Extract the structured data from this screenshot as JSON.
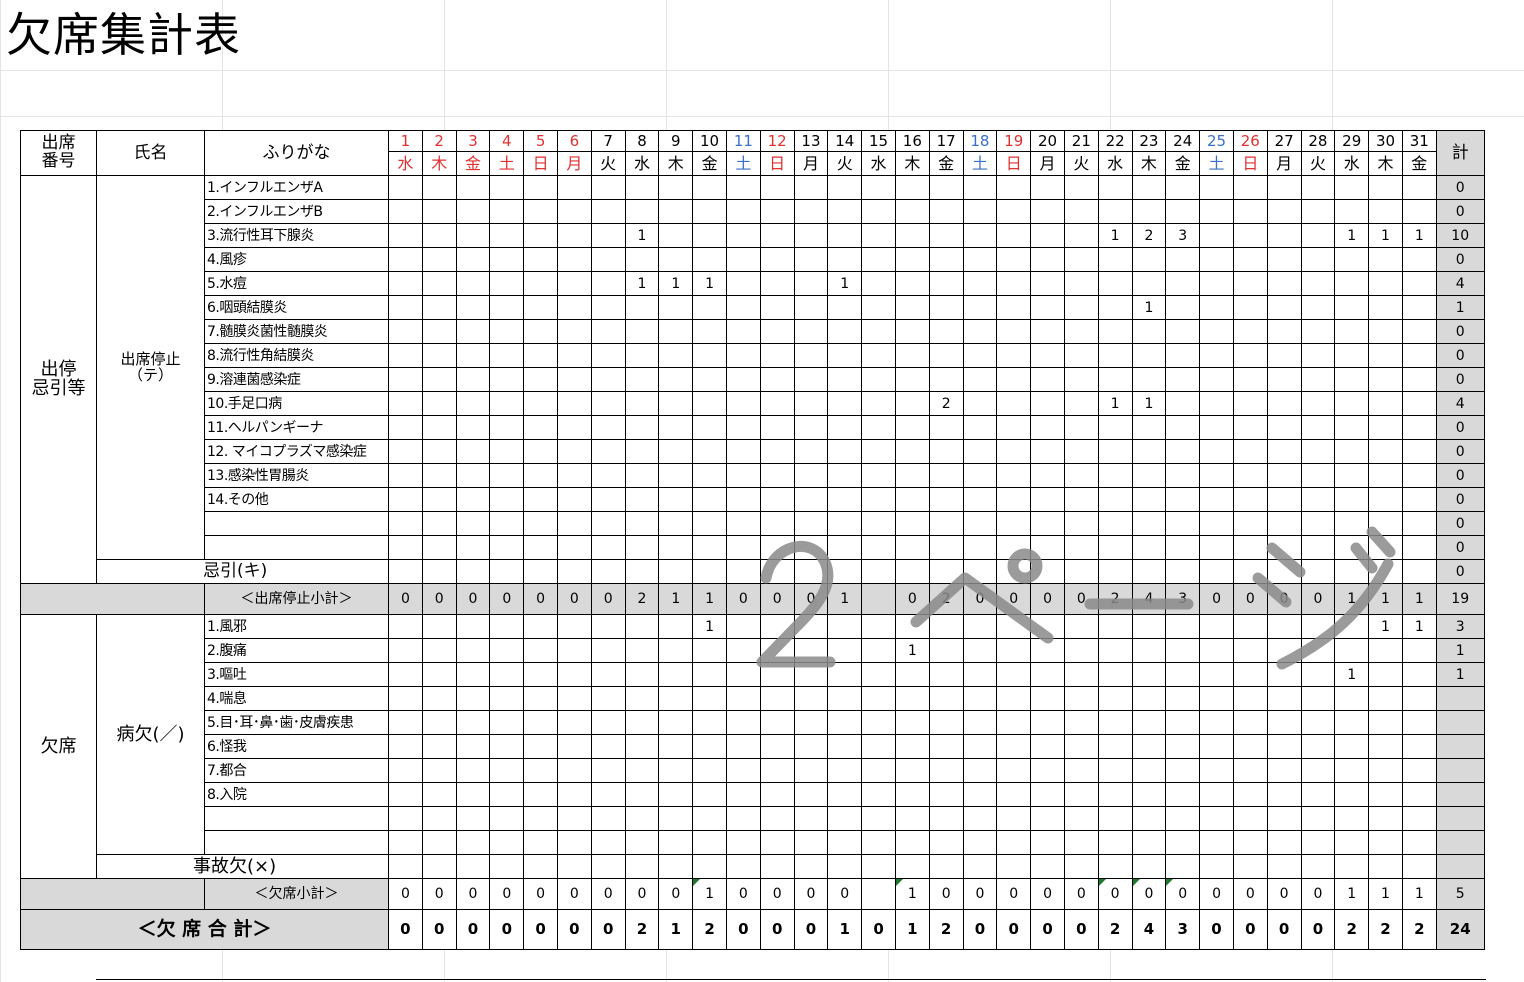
{
  "title": "欠席集計表",
  "header": {
    "number_label": "出席\n番号",
    "name_label": "氏名",
    "kana_label": "ふりがな",
    "total_label": "計"
  },
  "colors": {
    "saturday": "#3a6fc8",
    "holiday": "#e03030",
    "gray_fill": "#d9d9d9"
  },
  "days": [
    {
      "d": "1",
      "w": "水",
      "c": "red"
    },
    {
      "d": "2",
      "w": "木",
      "c": "red"
    },
    {
      "d": "3",
      "w": "金",
      "c": "red"
    },
    {
      "d": "4",
      "w": "土",
      "c": "red"
    },
    {
      "d": "5",
      "w": "日",
      "c": "red"
    },
    {
      "d": "6",
      "w": "月",
      "c": "red"
    },
    {
      "d": "7",
      "w": "火",
      "c": ""
    },
    {
      "d": "8",
      "w": "水",
      "c": ""
    },
    {
      "d": "9",
      "w": "木",
      "c": ""
    },
    {
      "d": "10",
      "w": "金",
      "c": ""
    },
    {
      "d": "11",
      "w": "土",
      "c": "blue"
    },
    {
      "d": "12",
      "w": "日",
      "c": "red"
    },
    {
      "d": "13",
      "w": "月",
      "c": ""
    },
    {
      "d": "14",
      "w": "火",
      "c": ""
    },
    {
      "d": "15",
      "w": "水",
      "c": ""
    },
    {
      "d": "16",
      "w": "木",
      "c": ""
    },
    {
      "d": "17",
      "w": "金",
      "c": ""
    },
    {
      "d": "18",
      "w": "土",
      "c": "blue"
    },
    {
      "d": "19",
      "w": "日",
      "c": "red"
    },
    {
      "d": "20",
      "w": "月",
      "c": ""
    },
    {
      "d": "21",
      "w": "火",
      "c": ""
    },
    {
      "d": "22",
      "w": "水",
      "c": ""
    },
    {
      "d": "23",
      "w": "木",
      "c": ""
    },
    {
      "d": "24",
      "w": "金",
      "c": ""
    },
    {
      "d": "25",
      "w": "土",
      "c": "blue"
    },
    {
      "d": "26",
      "w": "日",
      "c": "red"
    },
    {
      "d": "27",
      "w": "月",
      "c": ""
    },
    {
      "d": "28",
      "w": "火",
      "c": ""
    },
    {
      "d": "29",
      "w": "水",
      "c": ""
    },
    {
      "d": "30",
      "w": "木",
      "c": ""
    },
    {
      "d": "31",
      "w": "金",
      "c": ""
    }
  ],
  "section_suspension": {
    "group_label": "出停\n忌引等",
    "sub_label": "出席停止\n（テ）",
    "kibiki_label": "忌引(キ)",
    "kibiki_total": "0",
    "rows": [
      {
        "reason": "1.インフルエンザA",
        "cells": {},
        "total": "0"
      },
      {
        "reason": "2.インフルエンザB",
        "cells": {},
        "total": "0"
      },
      {
        "reason": "3.流行性耳下腺炎",
        "cells": {
          "8": "1",
          "22": "1",
          "23": "2",
          "24": "3",
          "29": "1",
          "30": "1",
          "31": "1"
        },
        "total": "10"
      },
      {
        "reason": "4.風疹",
        "cells": {},
        "total": "0"
      },
      {
        "reason": "5.水痘",
        "cells": {
          "8": "1",
          "9": "1",
          "10": "1",
          "14": "1"
        },
        "total": "4"
      },
      {
        "reason": "6.咽頭結膜炎",
        "cells": {
          "23": "1"
        },
        "total": "1"
      },
      {
        "reason": "7.髄膜炎菌性髄膜炎",
        "cells": {},
        "total": "0"
      },
      {
        "reason": "8.流行性角結膜炎",
        "cells": {},
        "total": "0"
      },
      {
        "reason": "9.溶連菌感染症",
        "cells": {},
        "total": "0"
      },
      {
        "reason": "10.手足口病",
        "cells": {
          "17": "2",
          "22": "1",
          "23": "1"
        },
        "total": "4"
      },
      {
        "reason": "11.ヘルパンギーナ",
        "cells": {},
        "total": "0"
      },
      {
        "reason": "12. マイコプラズマ感染症",
        "cells": {},
        "total": "0"
      },
      {
        "reason": "13.感染性胃腸炎",
        "cells": {},
        "total": "0"
      },
      {
        "reason": "14.その他",
        "cells": {},
        "total": "0"
      },
      {
        "reason": "",
        "cells": {},
        "total": "0"
      },
      {
        "reason": "",
        "cells": {},
        "total": "0"
      }
    ],
    "subtotal_label": "＜出席停止小計＞",
    "subtotal": [
      "0",
      "0",
      "0",
      "0",
      "0",
      "0",
      "0",
      "2",
      "1",
      "1",
      "0",
      "0",
      "0",
      "1",
      "",
      "0",
      "2",
      "0",
      "0",
      "0",
      "0",
      "2",
      "4",
      "3",
      "0",
      "0",
      "0",
      "0",
      "1",
      "1",
      "1"
    ],
    "subtotal_total": "19"
  },
  "section_absence": {
    "group_label": "欠席",
    "sub_label": "病欠(／)",
    "accident_label": "事故欠(×)",
    "rows": [
      {
        "reason": "1.風邪",
        "cells": {
          "10": "1",
          "30": "1",
          "31": "1"
        },
        "total": "3"
      },
      {
        "reason": "2.腹痛",
        "cells": {
          "16": "1"
        },
        "total": "1"
      },
      {
        "reason": "3.嘔吐",
        "cells": {
          "29": "1"
        },
        "total": "1"
      },
      {
        "reason": "4.喘息",
        "cells": {},
        "total": ""
      },
      {
        "reason": "5.目･耳･鼻･歯･皮膚疾患",
        "cells": {},
        "total": ""
      },
      {
        "reason": "6.怪我",
        "cells": {},
        "total": ""
      },
      {
        "reason": "7.都合",
        "cells": {},
        "total": ""
      },
      {
        "reason": "8.入院",
        "cells": {},
        "total": ""
      },
      {
        "reason": "",
        "cells": {},
        "total": ""
      },
      {
        "reason": "",
        "cells": {},
        "total": ""
      }
    ],
    "subtotal_label": "＜欠席小計＞",
    "subtotal": [
      "0",
      "0",
      "0",
      "0",
      "0",
      "0",
      "0",
      "0",
      "0",
      "1",
      "0",
      "0",
      "0",
      "0",
      "",
      "1",
      "0",
      "0",
      "0",
      "0",
      "0",
      "0",
      "0",
      "0",
      "0",
      "0",
      "0",
      "0",
      "1",
      "1",
      "1"
    ],
    "subtotal_total": "5"
  },
  "grand_total_label": "＜欠 席 合 計＞",
  "grand_total": [
    "0",
    "0",
    "0",
    "0",
    "0",
    "0",
    "0",
    "2",
    "1",
    "2",
    "0",
    "0",
    "0",
    "1",
    "0",
    "1",
    "2",
    "0",
    "0",
    "0",
    "0",
    "2",
    "4",
    "3",
    "0",
    "0",
    "0",
    "0",
    "2",
    "2",
    "2"
  ],
  "grand_total_sum": "24",
  "watermark": "2ページ"
}
